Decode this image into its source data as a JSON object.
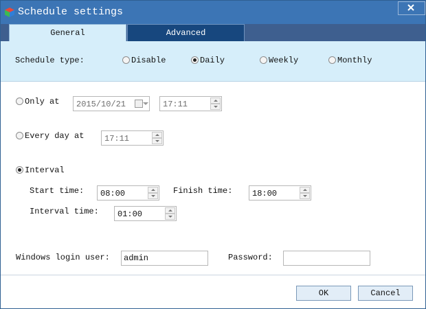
{
  "window": {
    "title": "Schedule settings",
    "close_symbol": "×",
    "app_icon": "app-cube-icon",
    "colors": {
      "titlebar": "#3c75b5",
      "tab_strip": "#3e5f8f",
      "tab_active": "#d6eefa",
      "tab_inactive": "#17477e"
    }
  },
  "tabs": [
    {
      "label": "General",
      "active": true
    },
    {
      "label": "Advanced",
      "active": false
    }
  ],
  "schedule_type": {
    "label": "Schedule type:",
    "options": [
      {
        "label": "Disable",
        "selected": false
      },
      {
        "label": "Daily",
        "selected": true
      },
      {
        "label": "Weekly",
        "selected": false
      },
      {
        "label": "Monthly",
        "selected": false
      }
    ]
  },
  "mode": {
    "only_at": {
      "label": "Only at",
      "selected": false,
      "date": "2015/10/21",
      "time": "17:11"
    },
    "every_day_at": {
      "label": "Every day at",
      "selected": false,
      "time": "17:11"
    },
    "interval": {
      "label": "Interval",
      "selected": true,
      "start_label": "Start time:",
      "start_value": "08:00",
      "finish_label": "Finish time:",
      "finish_value": "18:00",
      "interval_label": "Interval time:",
      "interval_value": "01:00"
    }
  },
  "login": {
    "user_label": "Windows login user:",
    "user_value": "admin",
    "password_label": "Password:",
    "password_value": ""
  },
  "buttons": {
    "ok": "OK",
    "cancel": "Cancel"
  }
}
